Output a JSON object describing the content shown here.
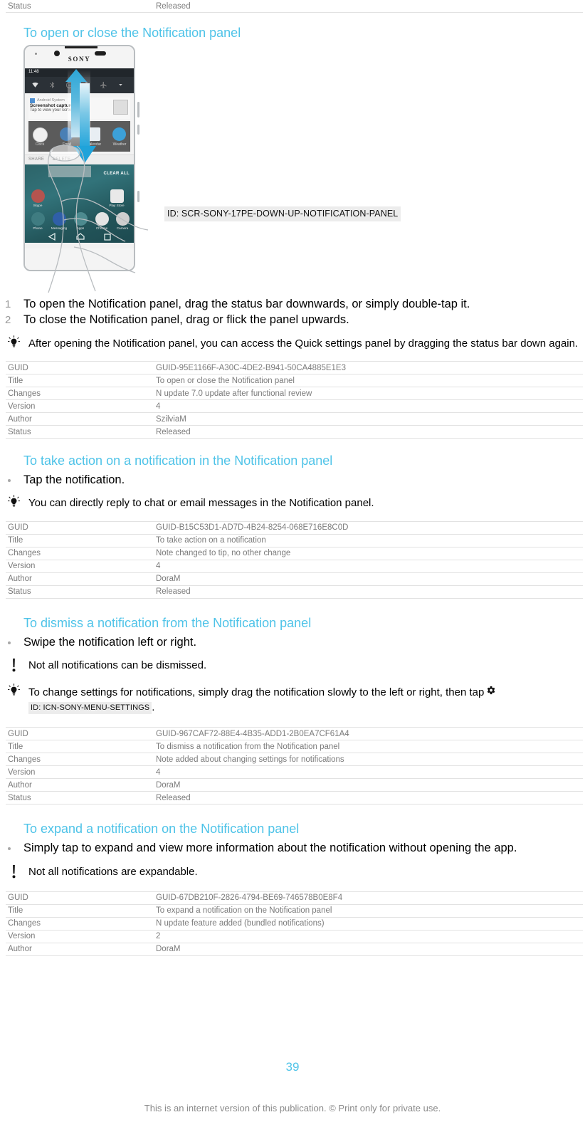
{
  "top_table_fragment": {
    "rows": [
      {
        "key": "Status",
        "value": "Released"
      }
    ]
  },
  "sections": [
    {
      "heading": "To open or close the Notification panel",
      "figure": {
        "id_label": "ID: SCR-SONY-17PE-DOWN-UP-NOTIFICATION-PANEL",
        "phone_brand": "SONY",
        "status_time": "11:48",
        "notification_app": "Android System",
        "notification_title": "Screenshot captured.",
        "notification_body": "Tap to view your screenshot.",
        "share_label": "SHARE",
        "delete_label": "DELETE",
        "clear_all_label": "CLEAR ALL",
        "quick_apps": [
          "Clock",
          "Email",
          "Calendar",
          "Weather"
        ],
        "home_apps": [
          "Skype",
          "Play Store",
          "Phone",
          "Messaging",
          "Apps",
          "Chrome",
          "Camera"
        ]
      },
      "steps": [
        {
          "num": "1",
          "text": "To open the Notification panel, drag the status bar downwards, or simply double-tap it."
        },
        {
          "num": "2",
          "text": "To close the Notification panel, drag or flick the panel upwards."
        }
      ],
      "notes": [
        {
          "type": "tip",
          "text": "After opening the Notification panel, you can access the Quick settings panel by dragging the status bar down again."
        }
      ],
      "table": {
        "rows": [
          {
            "key": "GUID",
            "value": "GUID-95E1166F-A30C-4DE2-B941-50CA4885E1E3"
          },
          {
            "key": "Title",
            "value": "To open or close the Notification panel"
          },
          {
            "key": "Changes",
            "value": "N update 7.0 update after functional review"
          },
          {
            "key": "Version",
            "value": "4"
          },
          {
            "key": "Author",
            "value": "SzilviaM"
          },
          {
            "key": "Status",
            "value": "Released"
          }
        ]
      }
    },
    {
      "heading": "To take action on a notification in the Notification panel",
      "bullets": [
        {
          "text": "Tap the notification."
        }
      ],
      "notes": [
        {
          "type": "tip",
          "text": "You can directly reply to chat or email messages in the Notification panel."
        }
      ],
      "table": {
        "rows": [
          {
            "key": "GUID",
            "value": "GUID-B15C53D1-AD7D-4B24-8254-068E716E8C0D"
          },
          {
            "key": "Title",
            "value": "To take action on a notification"
          },
          {
            "key": "Changes",
            "value": "Note changed to tip, no other change"
          },
          {
            "key": "Version",
            "value": "4"
          },
          {
            "key": "Author",
            "value": "DoraM"
          },
          {
            "key": "Status",
            "value": "Released"
          }
        ]
      }
    },
    {
      "heading": "To dismiss a notification from the Notification panel",
      "bullets": [
        {
          "text": "Swipe the notification left or right."
        }
      ],
      "notes": [
        {
          "type": "warn",
          "text": "Not all notifications can be dismissed."
        },
        {
          "type": "tip",
          "text_before": "To change settings for notifications, simply drag the notification slowly to the left or right, then tap",
          "inline_icon": "gear-icon",
          "inline_id_label": "ID: ICN-SONY-MENU-SETTINGS",
          "text_after": "."
        }
      ],
      "table": {
        "rows": [
          {
            "key": "GUID",
            "value": "GUID-967CAF72-88E4-4B35-ADD1-2B0EA7CF61A4"
          },
          {
            "key": "Title",
            "value": "To dismiss a notification from the Notification panel"
          },
          {
            "key": "Changes",
            "value": "Note added about changing settings for notifications"
          },
          {
            "key": "Version",
            "value": "4"
          },
          {
            "key": "Author",
            "value": "DoraM"
          },
          {
            "key": "Status",
            "value": "Released"
          }
        ]
      }
    },
    {
      "heading": "To expand a notification on the Notification panel",
      "bullets": [
        {
          "text": "Simply tap to expand and view more information about the notification without opening the app."
        }
      ],
      "notes": [
        {
          "type": "warn",
          "text": "Not all notifications are expandable."
        }
      ],
      "table": {
        "rows": [
          {
            "key": "GUID",
            "value": "GUID-67DB210F-2826-4794-BE69-746578B0E8F4"
          },
          {
            "key": "Title",
            "value": "To expand a notification on the Notification panel"
          },
          {
            "key": "Changes",
            "value": "N update feature added (bundled notifications)"
          },
          {
            "key": "Version",
            "value": "2"
          },
          {
            "key": "Author",
            "value": "DoraM"
          }
        ]
      }
    }
  ],
  "footer": {
    "page_number": "39",
    "note": "This is an internet version of this publication. © Print only for private use."
  },
  "colors": {
    "heading": "#4ec3e8",
    "page_number": "#4ec3e8",
    "table_text": "#7b7b7b",
    "arrow": "#29a8d8"
  }
}
